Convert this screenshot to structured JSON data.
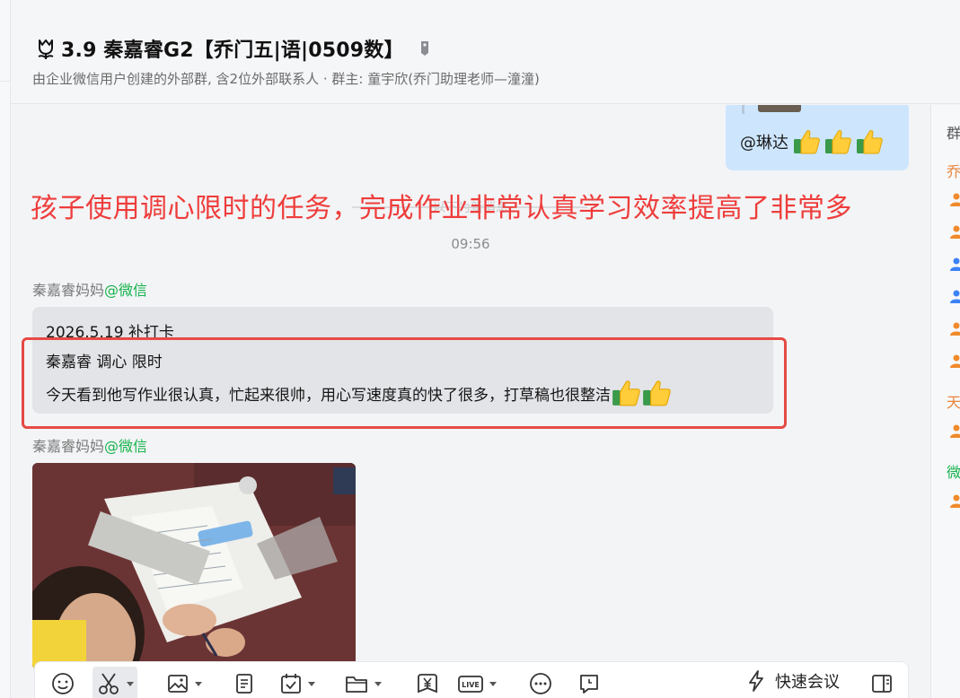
{
  "header": {
    "title": "3.9 秦嘉睿G2【乔门五|语|0509数】",
    "subtitle": "由企业微信用户创建的外部群, 含2位外部联系人 · 群主: 童宇欣(乔门助理老师—潼潼)"
  },
  "self_message": {
    "text": "@琳达"
  },
  "divider_text": "以下为新消息",
  "annotation": "孩子使用调心限时的任务，完成作业非常认真学习效率提高了非常多",
  "time": "09:56",
  "messages": [
    {
      "sender": "秦嘉睿妈妈",
      "source": "@微信",
      "lines": [
        "2026.5.19  补打卡",
        "秦嘉睿  调心 限时",
        "今天看到他写作业很认真，忙起来很帅，用心写速度真的快了很多，打草稿也很整洁"
      ]
    },
    {
      "sender": "秦嘉睿妈妈",
      "source": "@微信"
    }
  ],
  "toolbar": {
    "quick_meeting_label": "快速会议"
  },
  "right_panel": {
    "labels": [
      "群",
      "乔",
      "天",
      "微"
    ]
  },
  "colors": {
    "annotation": "#ee3d3b",
    "wechat_source": "#15b34b",
    "self_bubble": "#cde6fd",
    "highlight_box": "#e64a45"
  }
}
